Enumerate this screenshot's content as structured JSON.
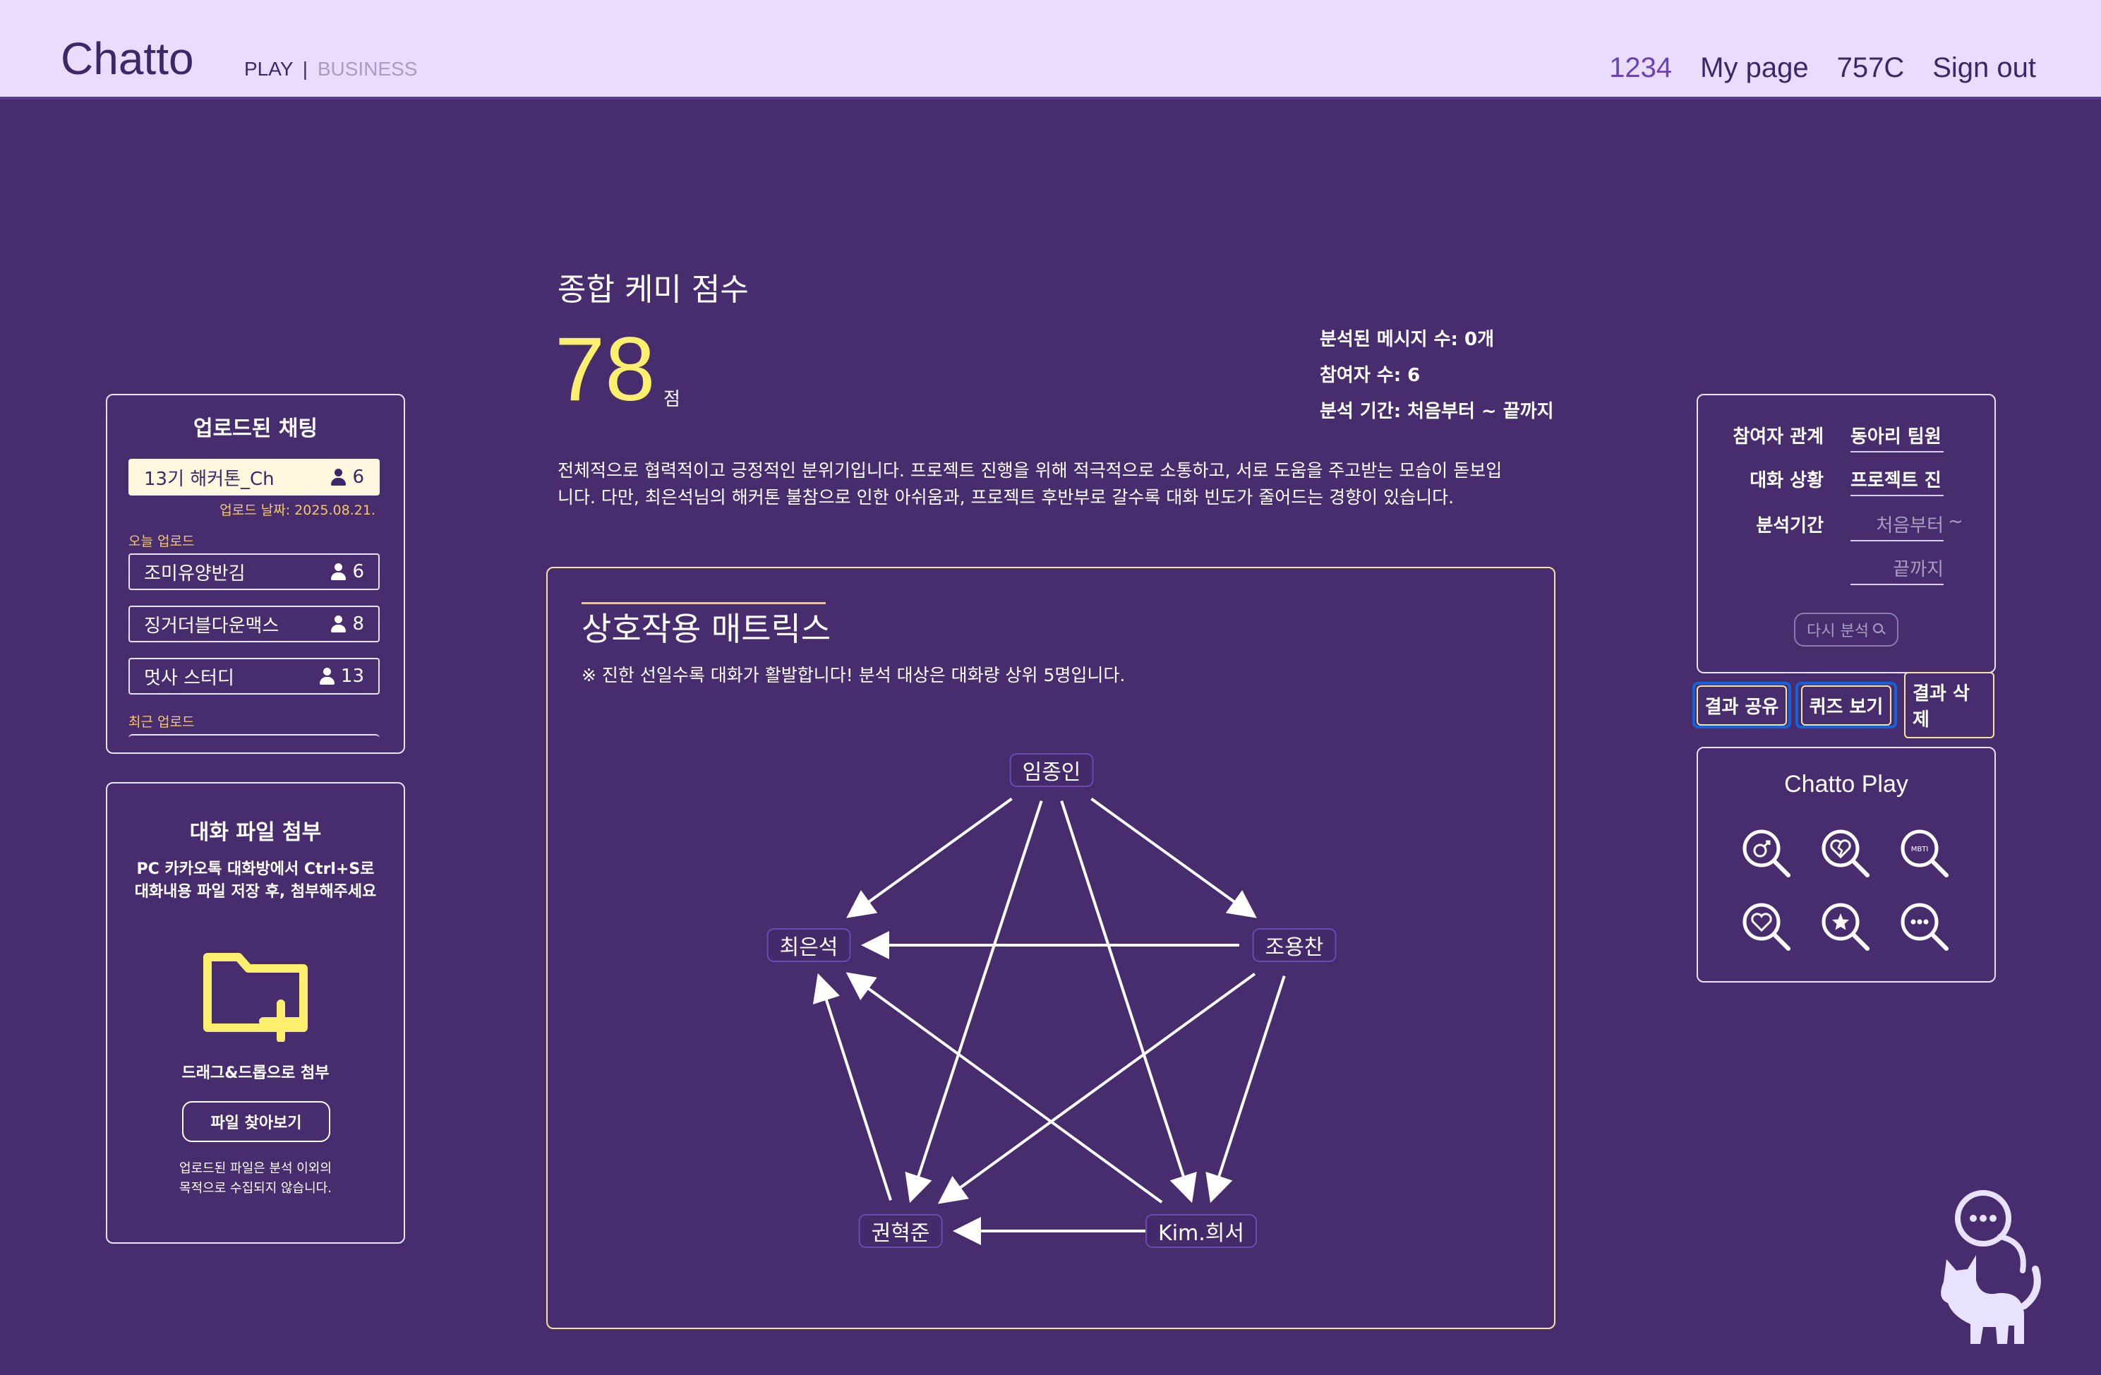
{
  "header": {
    "logo": "Chatto",
    "mode_play": "PLAY",
    "mode_sep": "|",
    "mode_business": "BUSINESS",
    "nav": {
      "user_code": "1234",
      "mypage": "My page",
      "account_code": "757C",
      "signout": "Sign out"
    }
  },
  "uploaded_chats": {
    "title": "업로드된 채팅",
    "active": {
      "name": "13기 해커톤_Ch",
      "count": "6",
      "upload_date": "업로드 날짜: 2025.08.21."
    },
    "today_label": "오늘 업로드",
    "today_items": [
      {
        "name": "조미유양반김",
        "count": "6"
      },
      {
        "name": "징거더블다운맥스",
        "count": "8"
      },
      {
        "name": "멋사 스터디",
        "count": "13"
      }
    ],
    "recent_label": "최근 업로드"
  },
  "attach": {
    "title": "대화 파일 첨부",
    "desc_line1": "PC 카카오톡 대화방에서 Ctrl+S로",
    "desc_line2": "대화내용 파일 저장 후, 첨부해주세요",
    "folder_icon": "folder-plus-icon",
    "drag_text": "드래그&드롭으로 첨부",
    "find_button": "파일 찾아보기",
    "note_line1": "업로드된 파일은 분석 이외의",
    "note_line2": "목적으로 수집되지 않습니다."
  },
  "score": {
    "title": "종합 케미 점수",
    "value": "78",
    "unit": "점",
    "stats": {
      "messages": "분석된 메시지 수: 0개",
      "participants": "참여자 수: 6",
      "period": "분석 기간: 처음부터 ~ 끝까지"
    },
    "summary_line1": "전체적으로 협력적이고 긍정적인 분위기입니다. 프로젝트 진행을 위해 적극적으로 소통하고, 서로 도움을 주고받는 모습이 돋보입",
    "summary_line2": "니다. 다만, 최은석님의 해커톤 불참으로 인한 아쉬움과, 프로젝트 후반부로 갈수록 대화 빈도가 줄어드는 경향이 있습니다."
  },
  "matrix": {
    "title": "상호작용 매트릭스",
    "note": "※ 진한 선일수록 대화가 활발합니다! 분석 대상은 대화량 상위 5명입니다.",
    "nodes": [
      "임종인",
      "최은석",
      "조용찬",
      "권혁준",
      "Kim.희서"
    ],
    "edges": [
      [
        "임종인",
        "최은석"
      ],
      [
        "임종인",
        "조용찬"
      ],
      [
        "임종인",
        "권혁준"
      ],
      [
        "임종인",
        "Kim.희서"
      ],
      [
        "조용찬",
        "최은석"
      ],
      [
        "조용찬",
        "권혁준"
      ],
      [
        "조용찬",
        "Kim.희서"
      ],
      [
        "권혁준",
        "최은석"
      ],
      [
        "Kim.희서",
        "최은석"
      ],
      [
        "Kim.희서",
        "권혁준"
      ]
    ]
  },
  "settings": {
    "relation_label": "참여자 관계",
    "relation_value": "동아리 팀원",
    "situation_label": "대화 상황",
    "situation_value": "프로젝트 진",
    "period_label": "분석기간",
    "period_start_placeholder": "처음부터",
    "period_tilde": "~",
    "period_end_placeholder": "끝까지",
    "reanalyze_button": "다시 분석"
  },
  "actions": {
    "share": "결과 공유",
    "quiz": "퀴즈 보기",
    "delete": "결과 삭제"
  },
  "play": {
    "title": "Chatto Play",
    "icons": [
      "search-gender-icon",
      "search-broken-heart-icon",
      "search-mbti-icon",
      "search-heart-icon",
      "search-star-icon",
      "search-dots-icon"
    ],
    "mbti_text": "MBTI"
  },
  "colors": {
    "background": "#472d6e",
    "header_bg": "#eadcff",
    "accent_yellow": "#fcef6e",
    "button_blue": "#1562d6"
  }
}
